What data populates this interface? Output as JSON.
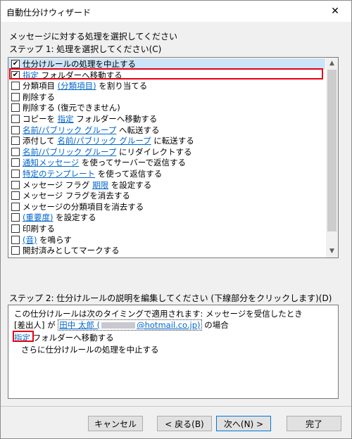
{
  "window": {
    "title": "自動仕分けウィザード",
    "close_symbol": "✕"
  },
  "prompt": "メッセージに対する処理を選択してください",
  "step1_label": "ステップ 1: 処理を選択してください(C)",
  "actions": [
    {
      "parts": [
        {
          "t": "仕分けルールの処理を中止する",
          "link": false
        }
      ],
      "checked": true,
      "selected": true
    },
    {
      "parts": [
        {
          "t": "指定",
          "link": true
        },
        {
          "t": " フォルダーへ移動する",
          "link": false
        }
      ],
      "checked": true,
      "selected": false
    },
    {
      "parts": [
        {
          "t": "分類項目 ",
          "link": false
        },
        {
          "t": "(分類項目)",
          "link": true
        },
        {
          "t": " を割り当てる",
          "link": false
        }
      ],
      "checked": false
    },
    {
      "parts": [
        {
          "t": "削除する",
          "link": false
        }
      ],
      "checked": false
    },
    {
      "parts": [
        {
          "t": "削除する (復元できません)",
          "link": false
        }
      ],
      "checked": false
    },
    {
      "parts": [
        {
          "t": "コピーを ",
          "link": false
        },
        {
          "t": "指定",
          "link": true
        },
        {
          "t": " フォルダーへ移動する",
          "link": false
        }
      ],
      "checked": false
    },
    {
      "parts": [
        {
          "t": "名前/パブリック グループ",
          "link": true
        },
        {
          "t": " へ転送する",
          "link": false
        }
      ],
      "checked": false
    },
    {
      "parts": [
        {
          "t": "添付して ",
          "link": false
        },
        {
          "t": "名前/パブリック グループ",
          "link": true
        },
        {
          "t": " に転送する",
          "link": false
        }
      ],
      "checked": false
    },
    {
      "parts": [
        {
          "t": "名前/パブリック グループ",
          "link": true
        },
        {
          "t": " にリダイレクトする",
          "link": false
        }
      ],
      "checked": false
    },
    {
      "parts": [
        {
          "t": "通知メッセージ",
          "link": true
        },
        {
          "t": " を使ってサーバーで返信する",
          "link": false
        }
      ],
      "checked": false
    },
    {
      "parts": [
        {
          "t": "特定のテンプレート",
          "link": true
        },
        {
          "t": " を使って返信する",
          "link": false
        }
      ],
      "checked": false
    },
    {
      "parts": [
        {
          "t": "メッセージ フラグ ",
          "link": false
        },
        {
          "t": "期限",
          "link": true
        },
        {
          "t": " を設定する",
          "link": false
        }
      ],
      "checked": false
    },
    {
      "parts": [
        {
          "t": "メッセージ フラグを消去する",
          "link": false
        }
      ],
      "checked": false
    },
    {
      "parts": [
        {
          "t": "メッセージの分類項目を消去する",
          "link": false
        }
      ],
      "checked": false
    },
    {
      "parts": [
        {
          "t": "(重要度)",
          "link": true
        },
        {
          "t": " を設定する",
          "link": false
        }
      ],
      "checked": false
    },
    {
      "parts": [
        {
          "t": "印刷する",
          "link": false
        }
      ],
      "checked": false
    },
    {
      "parts": [
        {
          "t": "(音)",
          "link": true
        },
        {
          "t": " を鳴らす",
          "link": false
        }
      ],
      "checked": false
    },
    {
      "parts": [
        {
          "t": "開封済みとしてマークする",
          "link": false
        }
      ],
      "checked": false
    }
  ],
  "step2_label": "ステップ 2: 仕分けルールの説明を編集してください (下線部分をクリックします)(D)",
  "description": {
    "line1": "この仕分けルールは次のタイミングで適用されます: メッセージを受信したとき",
    "line2_prefix": "[差出人] が ",
    "sender_name": "田中 太郎 (",
    "sender_domain": "@hotmail.co.jp)",
    "line2_suffix": " の場合",
    "line3_link": "指定",
    "line3_text": " フォルダーへ移動する",
    "line4": "さらに仕分けルールの処理を中止する"
  },
  "buttons": {
    "cancel": "キャンセル",
    "back": "< 戻る(B)",
    "next": "次へ(N) >",
    "finish": "完了"
  }
}
